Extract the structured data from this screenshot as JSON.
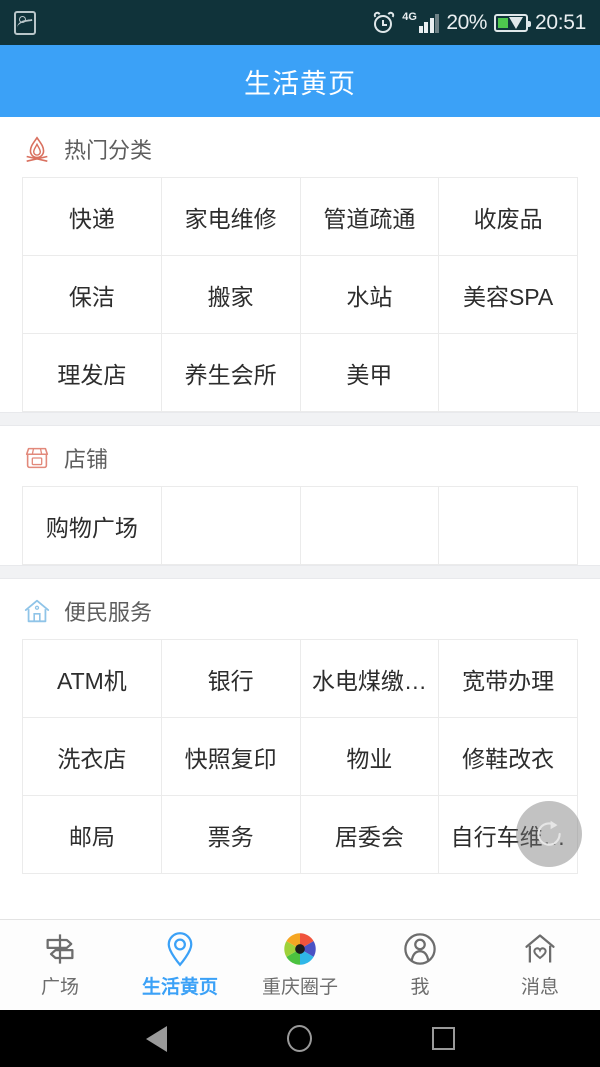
{
  "status_bar": {
    "screenshot_icon": "screenshot-icon",
    "alarm_icon": "alarm-clock-icon",
    "network_type": "4G",
    "battery_percent": "20%",
    "battery_icon": "battery-charging-icon",
    "time": "20:51"
  },
  "header": {
    "title": "生活黄页",
    "background": "#3ba1f7"
  },
  "sections": [
    {
      "key": "hot",
      "title": "热门分类",
      "icon": "campfire-icon",
      "icon_color": "#d9705f",
      "items": [
        "快递",
        "家电维修",
        "管道疏通",
        "收废品",
        "保洁",
        "搬家",
        "水站",
        "美容SPA",
        "理发店",
        "养生会所",
        "美甲",
        ""
      ]
    },
    {
      "key": "shops",
      "title": "店铺",
      "icon": "storefront-icon",
      "icon_color": "#e2897b",
      "items": [
        "购物广场",
        "",
        "",
        ""
      ]
    },
    {
      "key": "services",
      "title": "便民服务",
      "icon": "house-icon",
      "icon_color": "#8fc4e8",
      "items": [
        "ATM机",
        "银行",
        "水电煤缴…",
        "宽带办理",
        "洗衣店",
        "快照复印",
        "物业",
        "修鞋改衣",
        "邮局",
        "票务",
        "居委会",
        "自行车维…"
      ]
    }
  ],
  "fab": {
    "icon": "refresh-icon"
  },
  "tabbar": {
    "active_color": "#3ba1f7",
    "inactive_color": "#6d6d6d",
    "tabs": [
      {
        "label": "广场",
        "icon": "signpost-icon",
        "active": false
      },
      {
        "label": "生活黄页",
        "icon": "location-pin-icon",
        "active": true
      },
      {
        "label": "重庆圈子",
        "icon": "camera-aperture-icon",
        "active": false
      },
      {
        "label": "我",
        "icon": "user-profile-icon",
        "active": false
      },
      {
        "label": "消息",
        "icon": "house-heart-icon",
        "active": false
      }
    ]
  },
  "android_nav": {
    "back": "back-triangle-icon",
    "home": "home-circle-icon",
    "recents": "recents-square-icon"
  }
}
